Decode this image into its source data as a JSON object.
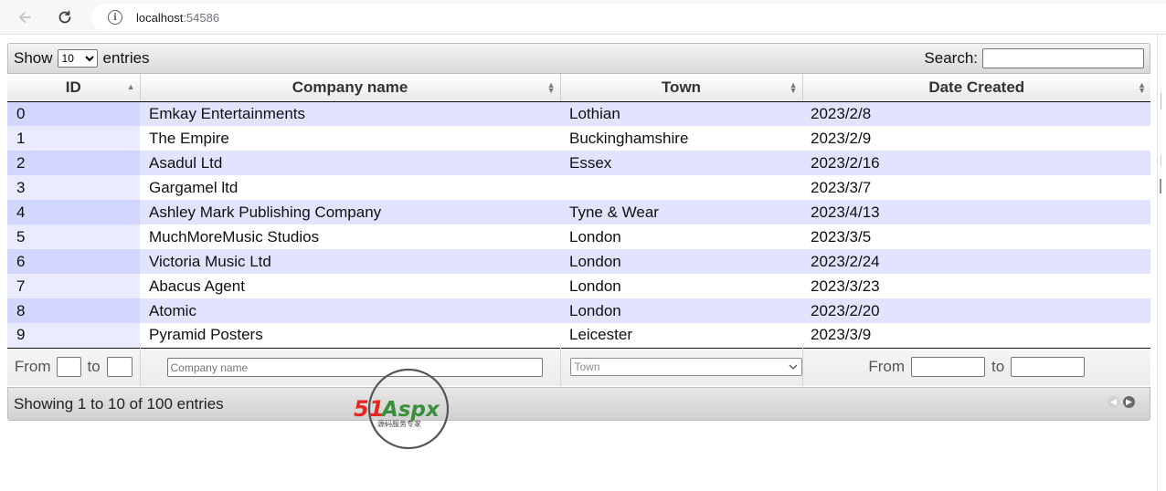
{
  "browser": {
    "url_host": "localhost",
    "url_port": ":54586"
  },
  "controls": {
    "show_label": "Show",
    "entries_label": "entries",
    "length_value": "10",
    "search_label": "Search:",
    "search_value": ""
  },
  "table": {
    "columns": [
      "ID",
      "Company name",
      "Town",
      "Date Created"
    ],
    "rows": [
      {
        "id": "0",
        "company": "Emkay Entertainments",
        "town": "Lothian",
        "date": "2023/2/8"
      },
      {
        "id": "1",
        "company": "The Empire",
        "town": "Buckinghamshire",
        "date": "2023/2/9"
      },
      {
        "id": "2",
        "company": "Asadul Ltd",
        "town": "Essex",
        "date": "2023/2/16"
      },
      {
        "id": "3",
        "company": "Gargamel ltd",
        "town": "",
        "date": "2023/3/7"
      },
      {
        "id": "4",
        "company": "Ashley Mark Publishing Company",
        "town": "Tyne & Wear",
        "date": "2023/4/13"
      },
      {
        "id": "5",
        "company": "MuchMoreMusic Studios",
        "town": "London",
        "date": "2023/3/5"
      },
      {
        "id": "6",
        "company": "Victoria Music Ltd",
        "town": "London",
        "date": "2023/2/24"
      },
      {
        "id": "7",
        "company": "Abacus Agent",
        "town": "London",
        "date": "2023/3/23"
      },
      {
        "id": "8",
        "company": "Atomic",
        "town": "London",
        "date": "2023/2/20"
      },
      {
        "id": "9",
        "company": "Pyramid Posters",
        "town": "Leicester",
        "date": "2023/3/9"
      }
    ]
  },
  "filters": {
    "from_label": "From",
    "to_label": "to",
    "company_placeholder": "Company name",
    "town_placeholder": "Town"
  },
  "footer": {
    "info": "Showing 1 to 10 of 100 entries"
  },
  "watermark": {
    "brand_a": "51",
    "brand_b": "Aspx",
    "tagline": "源码服务专家"
  }
}
